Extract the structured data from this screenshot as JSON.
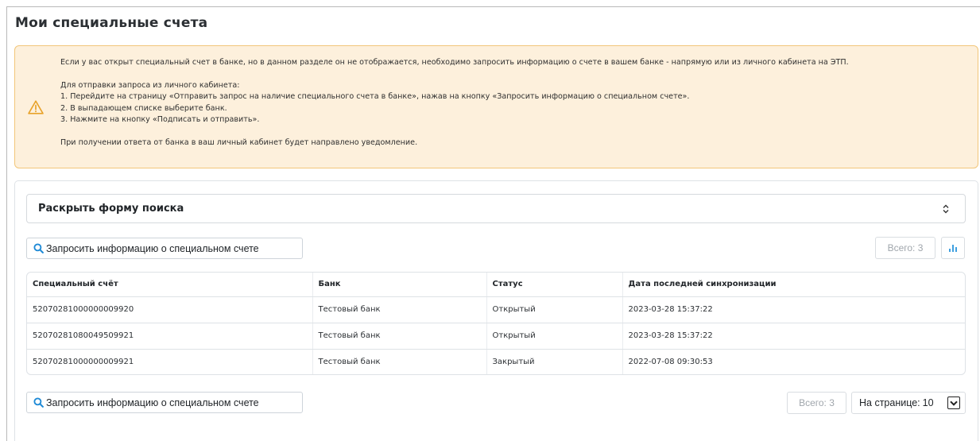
{
  "page": {
    "title": "Мои специальные счета"
  },
  "alert": {
    "icon": "warning-triangle-icon",
    "intro": "Если у вас открыт специальный счет в банке, но в данном разделе он не отображается, необходимо запросить информацию о счете в вашем банке - напрямую или из личного кабинета на ЭТП.",
    "steps_heading": "Для отправки запроса из личного кабинета:",
    "step1": "1. Перейдите на страницу «Отправить запрос на наличие специального счета в банке», нажав на кнопку «Запросить информацию о специальном счете».",
    "step2": "2. В выпадающем списке выберите банк.",
    "step3": "3. Нажмите на кнопку «Подписать и отправить».",
    "footer": "При получении ответа от банка в ваш личный кабинет будет направлено уведомление."
  },
  "search": {
    "toggle_label": "Раскрыть форму поиска",
    "caret": "⌃⌄"
  },
  "toolbar": {
    "request_label": "Запросить информацию о специальном счете",
    "total_label": "Всего: 3",
    "chart_icon": "bar-chart-icon"
  },
  "table": {
    "headers": [
      "Специальный счёт",
      "Банк",
      "Статус",
      "Дата последней синхронизации"
    ],
    "rows": [
      [
        "52070281000000009920",
        "Тестовый банк",
        "Открытый",
        "2023-03-28 15:37:22"
      ],
      [
        "52070281080049509921",
        "Тестовый банк",
        "Открытый",
        "2023-03-28 15:37:22"
      ],
      [
        "52070281000000009921",
        "Тестовый банк",
        "Закрытый",
        "2022-07-08 09:30:53"
      ]
    ]
  },
  "pagination": {
    "per_page_label": "На странице:",
    "per_page_value": "10"
  },
  "colors": {
    "alert_bg": "#fdf0dc",
    "alert_border": "#f2c67a",
    "warning_icon": "#e8a22a",
    "accent_blue": "#1f8ad6"
  }
}
